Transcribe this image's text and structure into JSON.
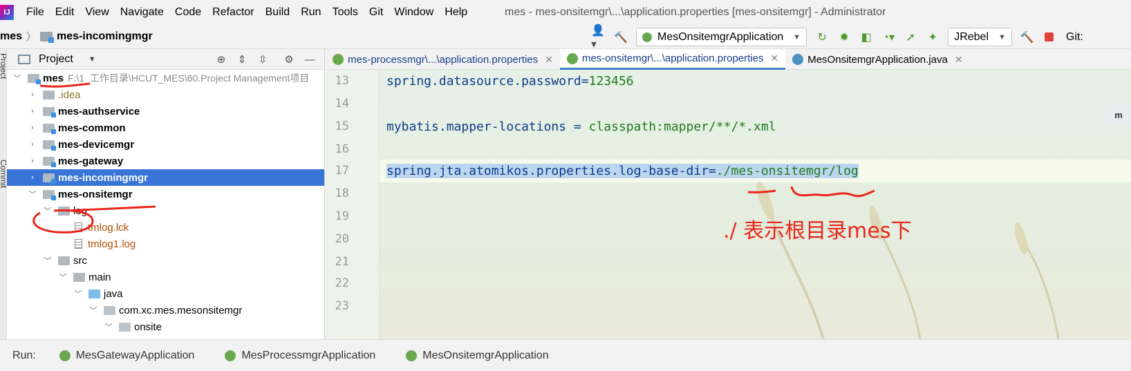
{
  "menubar": {
    "items": [
      "File",
      "Edit",
      "View",
      "Navigate",
      "Code",
      "Refactor",
      "Build",
      "Run",
      "Tools",
      "Git",
      "Window",
      "Help"
    ],
    "window_title": "mes - mes-onsitemgr\\...\\application.properties [mes-onsitemgr] - Administrator"
  },
  "navbar": {
    "crumb_root": "mes",
    "crumb_module": "mes-incomingmgr",
    "run_config": "MesOnsitemgrApplication",
    "jrebel": "JRebel",
    "git": "Git:"
  },
  "left_strip": {
    "project": "Project",
    "commit": "Commit"
  },
  "project_panel": {
    "title": "Project",
    "tree": [
      {
        "label": "mes",
        "path": "F:\\1_工作目录\\HCUT_MES\\60.Project Management项目",
        "kind": "module",
        "expanded": true,
        "bold": true
      },
      {
        "label": ".idea",
        "kind": "folder",
        "expanded": false
      },
      {
        "label": "mes-authservice",
        "kind": "module",
        "expanded": false,
        "bold": true
      },
      {
        "label": "mes-common",
        "kind": "module",
        "expanded": false,
        "bold": true
      },
      {
        "label": "mes-devicemgr",
        "kind": "module",
        "expanded": false,
        "bold": true
      },
      {
        "label": "mes-gateway",
        "kind": "module",
        "expanded": false,
        "bold": true
      },
      {
        "label": "mes-incomingmgr",
        "kind": "module",
        "expanded": false,
        "bold": true,
        "selected": true
      },
      {
        "label": "mes-onsitemgr",
        "kind": "module",
        "expanded": true,
        "bold": true
      },
      {
        "label": "log",
        "kind": "folder",
        "expanded": true
      },
      {
        "label": "tmlog.lck",
        "kind": "file"
      },
      {
        "label": "tmlog1.log",
        "kind": "file"
      },
      {
        "label": "src",
        "kind": "folder",
        "expanded": true
      },
      {
        "label": "main",
        "kind": "folder",
        "expanded": true
      },
      {
        "label": "java",
        "kind": "source",
        "expanded": true
      },
      {
        "label": "com.xc.mes.mesonsitemgr",
        "kind": "package",
        "expanded": true
      },
      {
        "label": "onsite",
        "kind": "package",
        "expanded": true
      }
    ]
  },
  "editor": {
    "tabs": [
      {
        "label": "mes-processmgr\\...\\application.properties",
        "active": false,
        "type": "props"
      },
      {
        "label": "mes-onsitemgr\\...\\application.properties",
        "active": true,
        "type": "props"
      },
      {
        "label": "MesOnsitemgrApplication.java",
        "active": false,
        "type": "java"
      }
    ],
    "lines": [
      {
        "num": "13",
        "key": "spring.datasource.password",
        "sep": "=",
        "value": "123456"
      },
      {
        "num": "14",
        "key": "",
        "sep": "",
        "value": ""
      },
      {
        "num": "15",
        "key": "mybatis.mapper-locations",
        "sep": " = ",
        "value": "classpath:mapper/**/*.xml"
      },
      {
        "num": "16",
        "key": "",
        "sep": "",
        "value": ""
      },
      {
        "num": "17",
        "key": "spring.jta.atomikos.properties.log-base-dir",
        "sep": "=",
        "value": "./mes-onsitemgr/log"
      },
      {
        "num": "18",
        "key": "",
        "sep": "",
        "value": ""
      },
      {
        "num": "19",
        "key": "",
        "sep": "",
        "value": ""
      },
      {
        "num": "20",
        "key": "",
        "sep": "",
        "value": ""
      },
      {
        "num": "21",
        "key": "",
        "sep": "",
        "value": ""
      },
      {
        "num": "22",
        "key": "",
        "sep": "",
        "value": ""
      },
      {
        "num": "23",
        "key": "",
        "sep": "",
        "value": ""
      }
    ],
    "annotation": "./ 表示根目录mes下",
    "badge": "m"
  },
  "runbar": {
    "label": "Run:",
    "tabs": [
      "MesGatewayApplication",
      "MesProcessmgrApplication",
      "MesOnsitemgrApplication"
    ]
  },
  "colors": {
    "selection": "#3875d7",
    "key": "#0b3b8c",
    "value": "#1f7a1f",
    "annotation": "#e8261c"
  }
}
